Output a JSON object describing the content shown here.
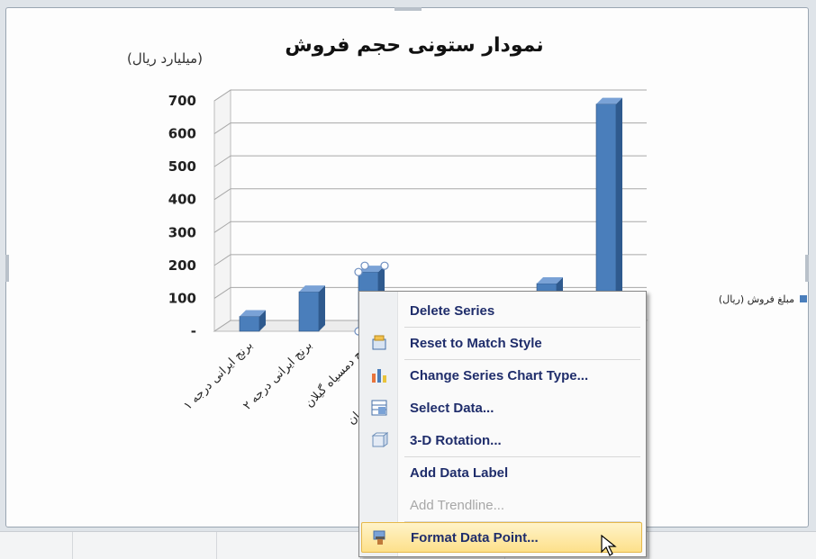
{
  "chart_data": {
    "type": "bar",
    "title": "نمودار ستونی حجم فروش",
    "ylabel": "(میلیارد ریال)",
    "xlabel": "",
    "ylim": [
      0,
      700
    ],
    "y_ticks": [
      "-",
      "100",
      "200",
      "300",
      "400",
      "500",
      "600",
      "700"
    ],
    "categories": [
      "برنج ایرانی درجه ۱",
      "برنج ایرانی درجه ۲",
      "برنج دمسیاه گیلان",
      "برنج درجه یک مازندران",
      "",
      "",
      ""
    ],
    "series": [
      {
        "name": "مبلغ فروش (ریال)",
        "values": [
          45,
          120,
          180,
          null,
          null,
          145,
          690
        ]
      }
    ],
    "selected_point_index": 2,
    "legend_position": "right",
    "grid": true,
    "colors": {
      "bar": "#4a7ebb",
      "bar_side": "#2f5a8e",
      "bar_top": "#7aa2d6"
    }
  },
  "context_menu": {
    "items": [
      {
        "label": "Delete Series",
        "icon": "",
        "disabled": false,
        "highlighted": false
      },
      {
        "label": "Reset to Match Style",
        "icon": "reset-style-icon",
        "disabled": false,
        "highlighted": false
      },
      {
        "label": "Change Series Chart Type...",
        "icon": "chart-type-icon",
        "disabled": false,
        "highlighted": false
      },
      {
        "label": "Select Data...",
        "icon": "select-data-icon",
        "disabled": false,
        "highlighted": false
      },
      {
        "label": "3-D Rotation...",
        "icon": "rotation-3d-icon",
        "disabled": false,
        "highlighted": false
      },
      {
        "label": "Add Data Label",
        "icon": "",
        "disabled": false,
        "highlighted": false
      },
      {
        "label": "Add Trendline...",
        "icon": "",
        "disabled": true,
        "highlighted": false
      },
      {
        "label": "Format Data Point...",
        "icon": "format-point-icon",
        "disabled": false,
        "highlighted": true
      }
    ]
  }
}
